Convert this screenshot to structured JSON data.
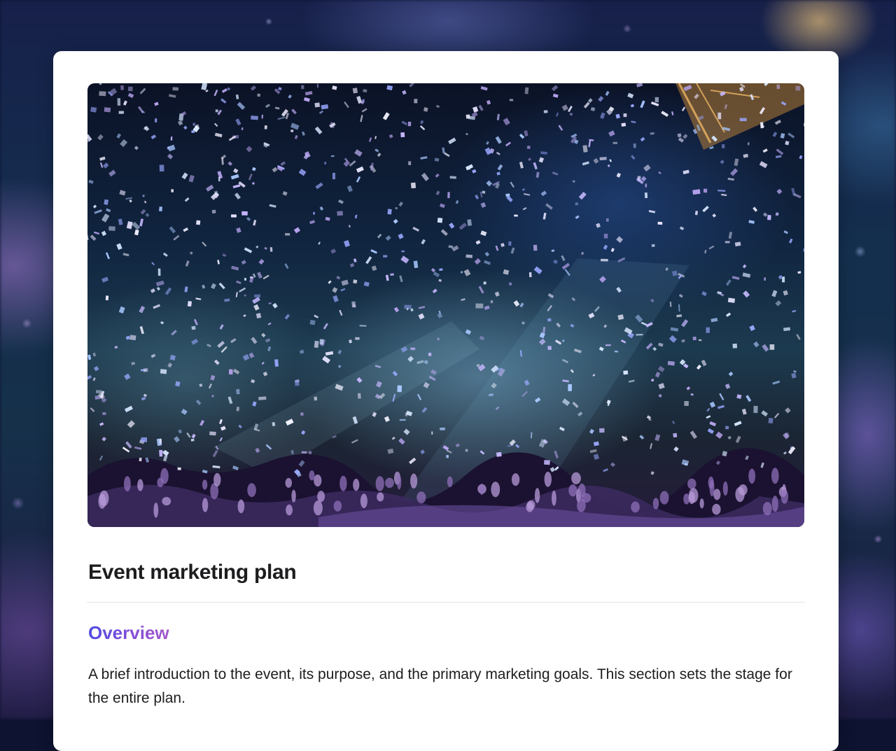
{
  "document": {
    "title": "Event marketing plan",
    "sections": [
      {
        "heading": "Overview",
        "body": "A brief introduction to the event, its purpose, and the primary marketing goals. This section sets the stage for the entire plan."
      }
    ]
  },
  "hero_image": {
    "subject": "concert crowd with confetti",
    "accent_colors": [
      "#1c3a4f",
      "#6a5acd",
      "#c7b8ff",
      "#0b1226"
    ]
  },
  "colors": {
    "heading_gradient_start": "#4f4ce0",
    "heading_gradient_end": "#a35bc9",
    "text": "#1d1d1f",
    "card": "#ffffff"
  }
}
